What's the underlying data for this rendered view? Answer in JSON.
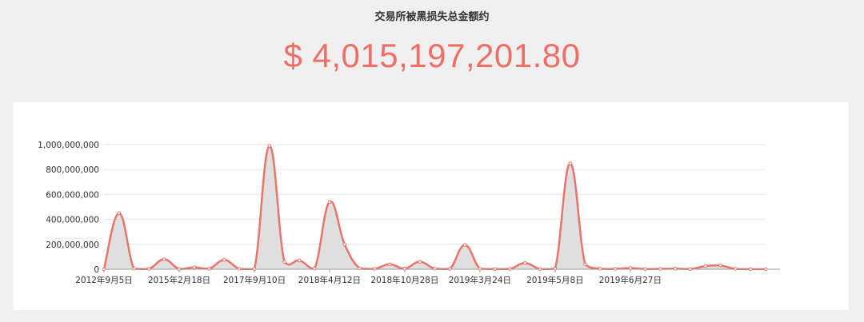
{
  "header": {
    "title": "交易所被黑损失总金额约",
    "total_amount": "$ 4,015,197,201.80"
  },
  "colors": {
    "background": "#efefef",
    "card": "#ffffff",
    "accent": "#ef6f67",
    "line": "#e8746c",
    "area": "#d9d9d9",
    "grid": "#e3e3e3",
    "axis": "#999999",
    "text": "#333333"
  },
  "chart_data": {
    "type": "area",
    "title": "",
    "xlabel": "",
    "ylabel": "",
    "ylim": [
      0,
      1000000000
    ],
    "yticks": [
      0,
      200000000,
      400000000,
      600000000,
      800000000,
      1000000000
    ],
    "ytick_labels": [
      "0",
      "200,000,000",
      "400,000,000",
      "600,000,000",
      "800,000,000",
      "1,000,000,000"
    ],
    "xtick_labels": [
      "2012年9月5日",
      "2015年2月18日",
      "2017年9月10日",
      "2018年4月12日",
      "2018年10月28日",
      "2019年3月24日",
      "2019年5月8日",
      "2019年6月27日"
    ],
    "xtick_positions": [
      0,
      5,
      10,
      15,
      20,
      25,
      30,
      35
    ],
    "grid": true,
    "legend": "none",
    "series": [
      {
        "values": [
          0,
          450000000,
          5000000,
          3000000,
          80000000,
          2000000,
          15000000,
          5000000,
          75000000,
          3000000,
          2000000,
          990000000,
          60000000,
          70000000,
          5000000,
          540000000,
          200000000,
          8000000,
          4000000,
          40000000,
          6000000,
          60000000,
          5000000,
          3000000,
          195000000,
          4000000,
          2000000,
          3000000,
          50000000,
          2000000,
          5000000,
          850000000,
          40000000,
          5000000,
          3000000,
          10000000,
          2000000,
          3000000,
          5000000,
          2000000,
          25000000,
          30000000,
          3000000,
          1000000,
          500000
        ]
      }
    ]
  }
}
